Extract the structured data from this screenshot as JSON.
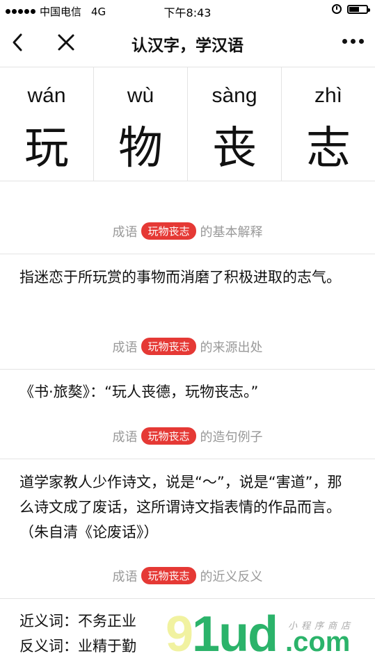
{
  "status_bar": {
    "carrier": "中国电信",
    "network": "4G",
    "time": "下午8:43"
  },
  "nav": {
    "title": "认汉字，学汉语"
  },
  "characters": [
    {
      "pinyin": "wán",
      "hanzi": "玩"
    },
    {
      "pinyin": "wù",
      "hanzi": "物"
    },
    {
      "pinyin": "sàng",
      "hanzi": "丧"
    },
    {
      "pinyin": "zhì",
      "hanzi": "志"
    }
  ],
  "sections": {
    "prefix": "成语",
    "idiom": "玩物丧志",
    "basic_suffix": "的基本解释",
    "basic_text": "指迷恋于所玩赏的事物而消磨了积极进取的志气。",
    "source_suffix": "的来源出处",
    "source_text": "《书·旅獒》：“玩人丧德，玩物丧志。”",
    "example_suffix": "的造句例子",
    "example_text": "道学家教人少作诗文，说是“～”，说是“害道”，那么诗文成了废话，这所谓诗文指表情的作品而言。（朱自清《论废话》）",
    "synonym_suffix": "的近义反义",
    "synonym_line": "近义词：不务正业",
    "antonym_line": "反义词：业精于勤"
  },
  "watermark": {
    "logo_part1": "9",
    "logo_part2": "1ud",
    "dotcom": ".com",
    "sub": "小程序商店"
  },
  "colors": {
    "badge": "#e53935",
    "header_gray": "#999999",
    "watermark_green": "#2bb36a"
  }
}
